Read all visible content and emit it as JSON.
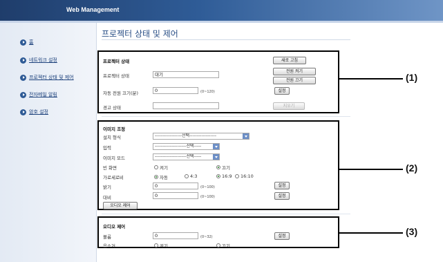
{
  "header": {
    "title": "Web Management"
  },
  "sidebar": {
    "items": [
      {
        "label": "홈"
      },
      {
        "label": "네트워크 설정"
      },
      {
        "label": "프로젝터 상태 및 제어"
      },
      {
        "label": "전자메일 알림"
      },
      {
        "label": "암호 설정"
      }
    ]
  },
  "main": {
    "title": "프로젝터 상태 및 제어"
  },
  "status_panel": {
    "title": "프로젝터 상태",
    "refresh_button": "새로 고침",
    "power_on_button": "전원 켜기",
    "power_off_button": "전원 끄기",
    "projector_status_label": "프로젝터 상태",
    "projector_status_value": "대기",
    "auto_power_off_label": "자동 전원 끄기(분)",
    "auto_power_off_value": "0",
    "auto_power_off_range": "(0~120)",
    "set_button": "설정",
    "warning_label": "경고 상태",
    "warning_value": "",
    "clear_button": "지우기"
  },
  "image_panel": {
    "title": "이미지 조정",
    "installation_label": "설치 형식",
    "installation_value": "------------------선택------------------",
    "input_label": "입력",
    "input_value": "---------------------선택-----",
    "image_mode_label": "이미지 모드",
    "image_mode_value": "---------------------선택-----",
    "blank_label": "빈 화면",
    "blank_on": "켜기",
    "blank_off": "끄기",
    "aspect_label": "가로세로비",
    "aspect_auto": "자동",
    "aspect_43": "4:3",
    "aspect_169": "16:9",
    "aspect_1610": "16:10",
    "brightness_label": "밝기",
    "brightness_value": "0",
    "brightness_range": "(0~100)",
    "contrast_label": "대비",
    "contrast_value": "0",
    "contrast_range": "(0~100)",
    "set_button": "설정",
    "audio_control_button": "오디오 제어"
  },
  "audio_panel": {
    "title": "오디오 제어",
    "volume_label": "볼륨",
    "volume_value": "0",
    "volume_range": "(0~32)",
    "set_button": "설정",
    "mute_label": "음소거",
    "mute_on": "켜기",
    "mute_off": "끄기"
  },
  "callouts": {
    "c1": "(1)",
    "c2": "(2)",
    "c3": "(3)"
  }
}
